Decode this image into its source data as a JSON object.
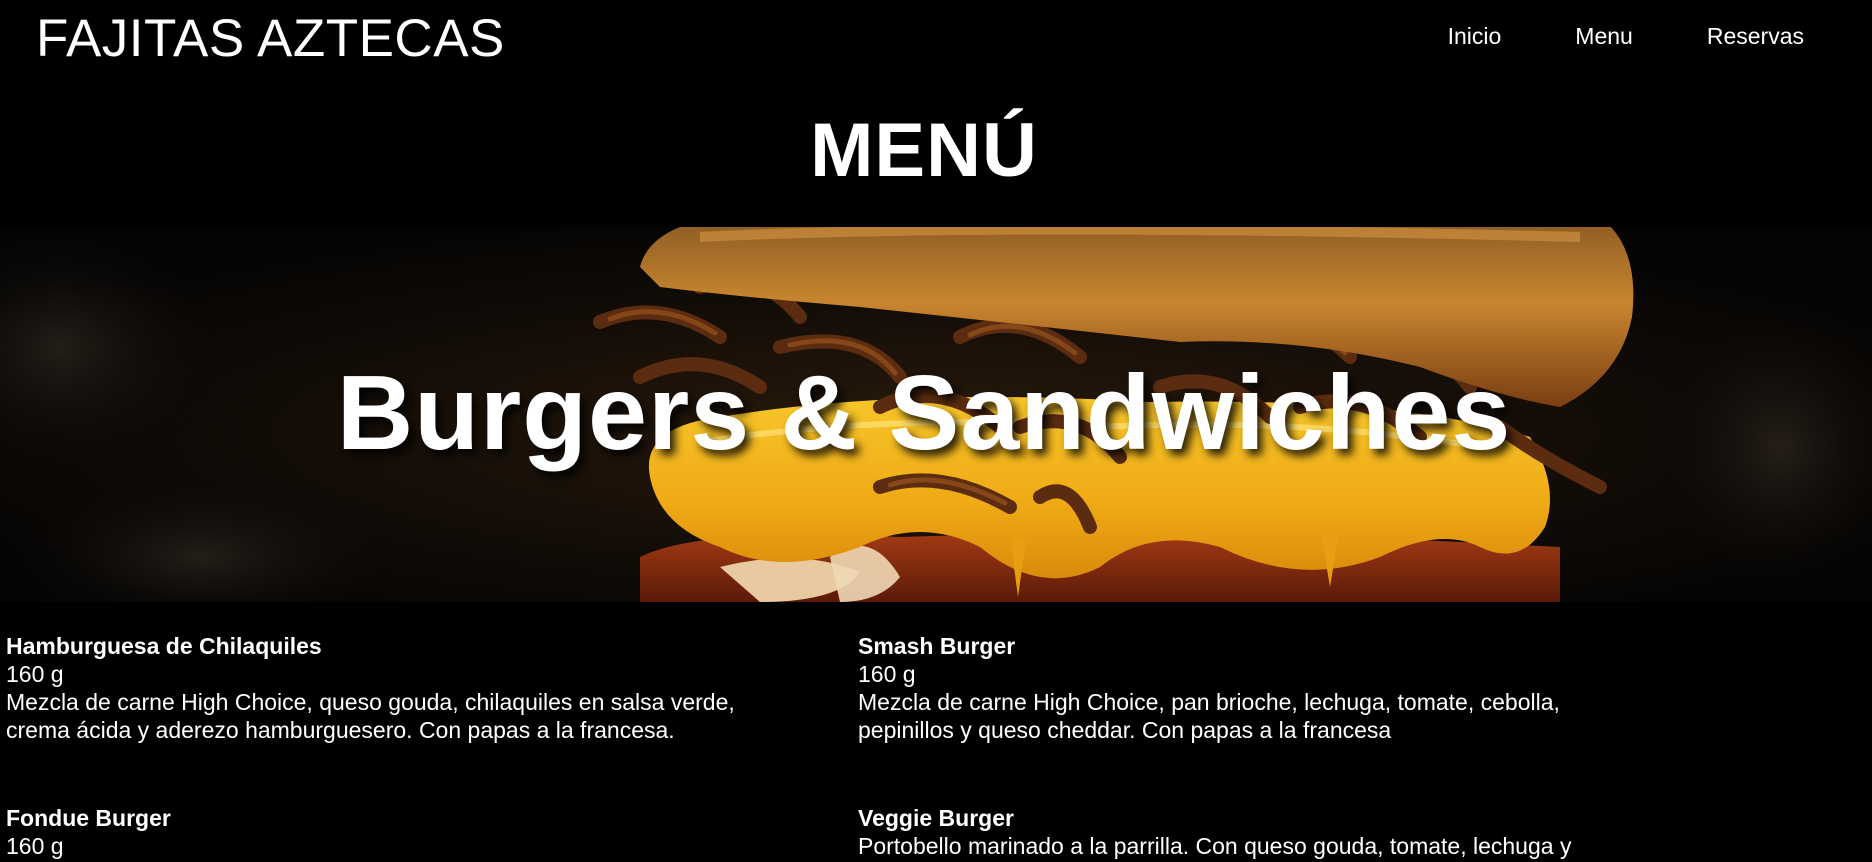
{
  "header": {
    "brand": "FAJITAS AZTECAS",
    "nav": [
      {
        "label": "Inicio"
      },
      {
        "label": "Menu"
      },
      {
        "label": "Reservas"
      }
    ]
  },
  "page_title": "MENÚ",
  "hero": {
    "title": "Burgers & Sandwiches"
  },
  "items": [
    {
      "name": "Hamburguesa de Chilaquiles",
      "weight": "160 g",
      "description": "Mezcla de carne High Choice, queso gouda, chilaquiles en salsa verde, crema ácida y aderezo hamburguesero. Con papas a la francesa."
    },
    {
      "name": "Smash Burger",
      "weight": "160 g",
      "description": "Mezcla de carne High Choice, pan brioche, lechuga, tomate, cebolla, pepinillos y queso cheddar. Con papas a la francesa"
    },
    {
      "name": "Fondue Burger",
      "weight": "160 g",
      "description": ""
    },
    {
      "name": "Veggie Burger",
      "weight": "",
      "description": "Portobello marinado a la parrilla. Con queso gouda, tomate, lechuga y"
    }
  ],
  "colors": {
    "background": "#000000",
    "text": "#ffffff",
    "cheese": "#f2b51c",
    "bun": "#c8781e"
  }
}
